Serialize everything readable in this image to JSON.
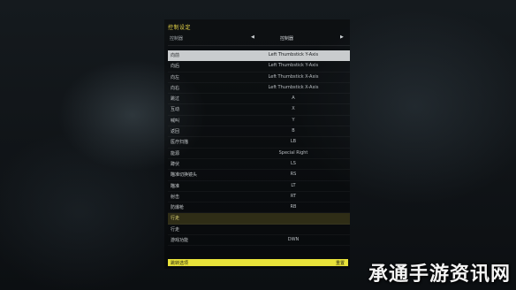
{
  "title": "控制设定",
  "profile": {
    "label": "控制器",
    "value": "控制器",
    "left_arrow": "◀",
    "right_arrow": "▶"
  },
  "rows": [
    {
      "action": "向前",
      "binding": "Left Thumbstick Y-Axis",
      "state": "selected"
    },
    {
      "action": "向后",
      "binding": "Left Thumbstick Y-Axis",
      "state": "normal"
    },
    {
      "action": "向左",
      "binding": "Left Thumbstick X-Axis",
      "state": "normal"
    },
    {
      "action": "向右",
      "binding": "Left Thumbstick X-Axis",
      "state": "normal"
    },
    {
      "action": "跳过",
      "binding": "A",
      "state": "normal"
    },
    {
      "action": "互动",
      "binding": "X",
      "state": "normal"
    },
    {
      "action": "喊叫",
      "binding": "Y",
      "state": "normal"
    },
    {
      "action": "返回",
      "binding": "B",
      "state": "normal"
    },
    {
      "action": "医疗扫描",
      "binding": "LB",
      "state": "normal"
    },
    {
      "action": "能源",
      "binding": "Special Right",
      "state": "normal"
    },
    {
      "action": "蹲伏",
      "binding": "LS",
      "state": "normal"
    },
    {
      "action": "瞄准切换镜头",
      "binding": "RS",
      "state": "normal"
    },
    {
      "action": "瞄准",
      "binding": "LT",
      "state": "normal"
    },
    {
      "action": "射击",
      "binding": "RT",
      "state": "normal"
    },
    {
      "action": "防爆枪",
      "binding": "RB",
      "state": "normal"
    },
    {
      "action": "行走",
      "binding": "",
      "state": "highlight"
    },
    {
      "action": "行走",
      "binding": "",
      "state": "normal"
    },
    {
      "action": "游戏功能",
      "binding": "DWN",
      "state": "normal"
    }
  ],
  "footer": {
    "left": "跳转选项",
    "right": "重置"
  },
  "watermark": "承通手游资讯网"
}
